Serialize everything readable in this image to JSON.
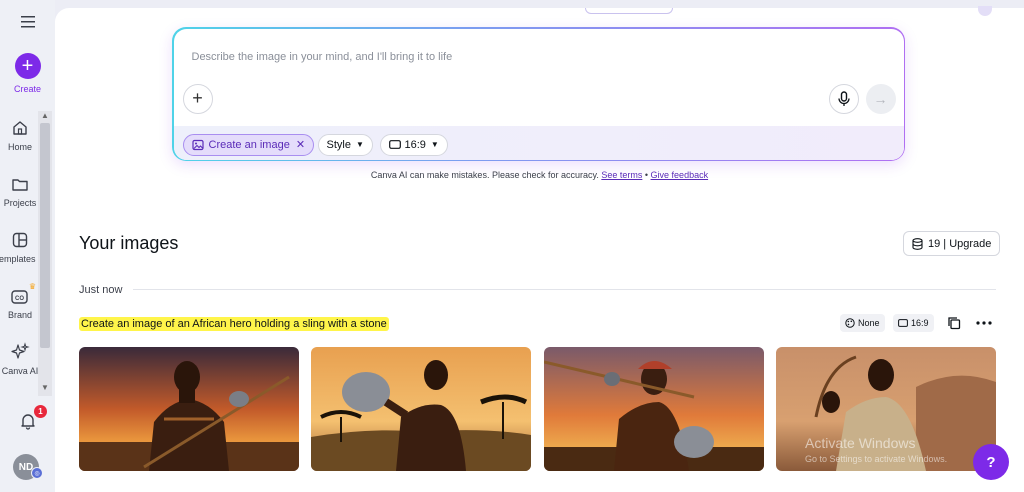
{
  "sidebar": {
    "create_label": "Create",
    "items": [
      {
        "label": "Home",
        "icon": "home-icon"
      },
      {
        "label": "Projects",
        "icon": "folder-icon"
      },
      {
        "label": "Templates",
        "icon": "template-icon"
      },
      {
        "label": "Brand",
        "icon": "brand-icon"
      },
      {
        "label": "Canva AI",
        "icon": "sparkle-icon"
      }
    ],
    "notification_count": "1",
    "avatar_initials": "ND"
  },
  "prompt": {
    "placeholder": "Describe the image in your mind, and I'll bring it to life",
    "chips": {
      "mode": "Create an image",
      "style": "Style",
      "ratio": "16:9"
    }
  },
  "disclaimer": {
    "text": "Canva AI can make mistakes. Please check for accuracy.",
    "see_terms": "See terms",
    "separator": "•",
    "give_feedback": "Give feedback"
  },
  "images_section": {
    "title": "Your images",
    "credits": "19 | Upgrade",
    "time_label": "Just now",
    "prompt_text": "Create an image of an African hero holding a sling with a stone",
    "meta_style": "None",
    "meta_ratio": "16:9"
  },
  "overlay": {
    "watermark_title": "Activate Windows",
    "watermark_sub": "Go to Settings to activate Windows.",
    "help": "?"
  },
  "colors": {
    "accent": "#7d2ae8",
    "highlight": "#fff54a",
    "badge": "#e8283c"
  }
}
